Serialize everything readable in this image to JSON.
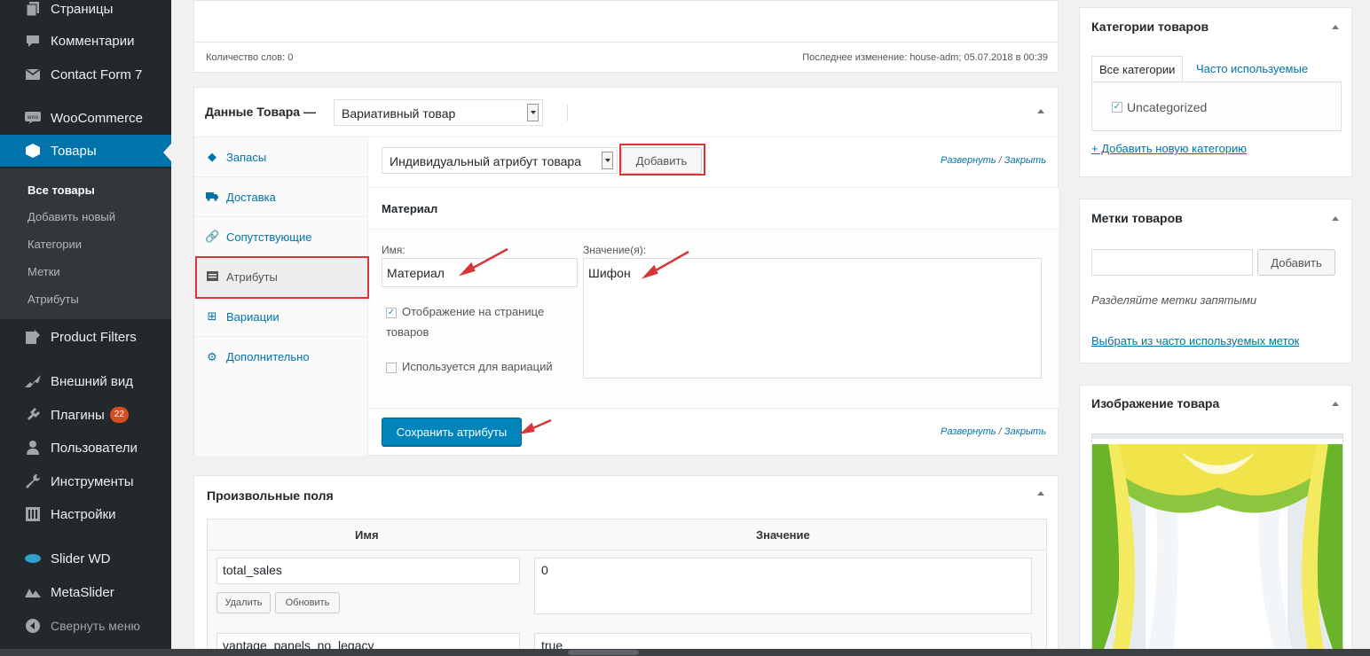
{
  "sidebar": {
    "items": [
      {
        "label": "Страницы",
        "icon": "pages-icon"
      },
      {
        "label": "Комментарии",
        "icon": "comments-icon"
      },
      {
        "label": "Contact Form 7",
        "icon": "mail-icon"
      },
      {
        "label": "WooCommerce",
        "icon": "woocommerce-icon"
      },
      {
        "label": "Товары",
        "icon": "products-icon"
      },
      {
        "label": "Product Filters",
        "icon": "filter-icon"
      },
      {
        "label": "Внешний вид",
        "icon": "appearance-icon"
      },
      {
        "label": "Плагины",
        "icon": "plugins-icon"
      },
      {
        "label": "Пользователи",
        "icon": "users-icon"
      },
      {
        "label": "Инструменты",
        "icon": "tools-icon"
      },
      {
        "label": "Настройки",
        "icon": "settings-icon"
      },
      {
        "label": "Slider WD",
        "icon": "slider-icon"
      },
      {
        "label": "MetaSlider",
        "icon": "metaslider-icon"
      },
      {
        "label": "Свернуть меню",
        "icon": "collapse-icon"
      }
    ],
    "plugins_badge": "22",
    "submenu": [
      "Все товары",
      "Добавить новый",
      "Категории",
      "Метки",
      "Атрибуты"
    ]
  },
  "editor": {
    "word_count": "Количество слов: 0",
    "last_edit": "Последнее изменение: house-adm; 05.07.2018 в 00:39"
  },
  "product_data": {
    "title": "Данные Товара —",
    "type_select": "Вариативный товар",
    "tabs": [
      "Запасы",
      "Доставка",
      "Сопутствующие",
      "Атрибуты",
      "Вариации",
      "Дополнительно"
    ],
    "attribute_select": "Индивидуальный атрибут товара",
    "add_button": "Добавить",
    "expand": "Развернуть",
    "slash": " / ",
    "close": "Закрыть",
    "attribute_heading": "Материал",
    "name_label": "Имя:",
    "name_value": "Материал",
    "values_label": "Значение(я):",
    "values_value": "Шифон",
    "visible_label": "Отображение на странице товаров",
    "variations_label": "Используется для вариаций",
    "save_button": "Сохранить атрибуты"
  },
  "custom_fields": {
    "title": "Произвольные поля",
    "col_name": "Имя",
    "col_value": "Значение",
    "rows": [
      {
        "name": "total_sales",
        "value": "0"
      },
      {
        "name": "vantage_panels_no_legacy",
        "value": "true"
      }
    ],
    "delete_button": "Удалить",
    "update_button": "Обновить"
  },
  "categories": {
    "title": "Категории товаров",
    "tab_all": "Все категории",
    "tab_popular": "Часто используемые",
    "items": [
      "Uncategorized"
    ],
    "add_link": "+ Добавить новую категорию"
  },
  "tags": {
    "title": "Метки товаров",
    "add_button": "Добавить",
    "hint": "Разделяйте метки запятыми",
    "popular_link": "Выбрать из часто используемых меток"
  },
  "image": {
    "title": "Изображение товара"
  },
  "colors": {
    "sidebar": "#23282d",
    "accent": "#0073aa",
    "primary_button": "#0085ba",
    "highlight": "#d63638"
  }
}
